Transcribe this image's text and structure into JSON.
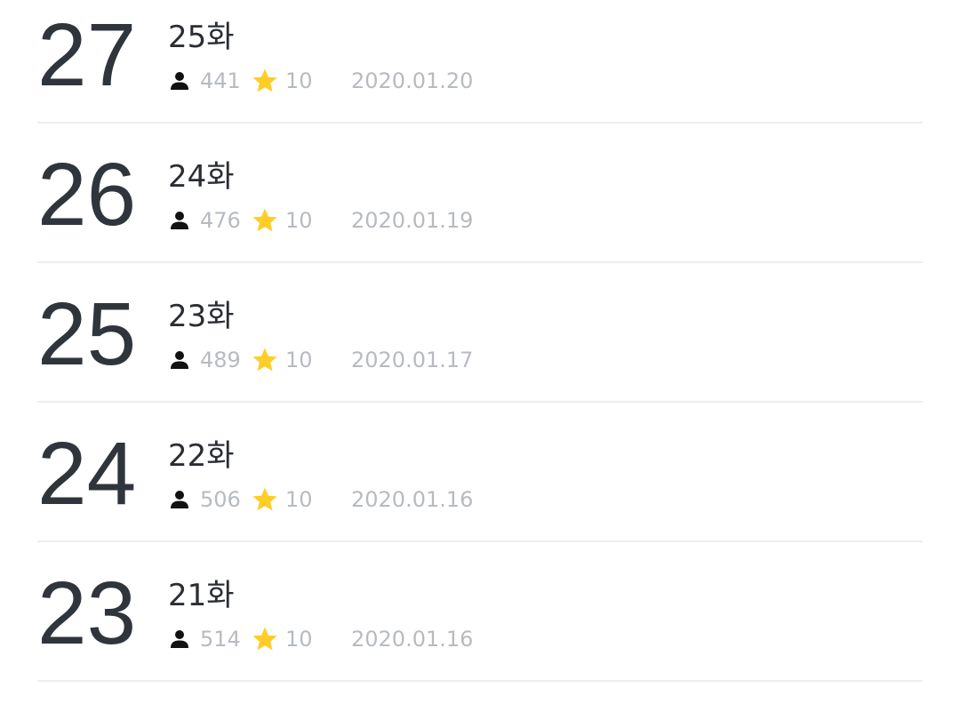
{
  "episodes": [
    {
      "number": "27",
      "title": "25화",
      "views": "441",
      "rating": "10",
      "date": "2020.01.20"
    },
    {
      "number": "26",
      "title": "24화",
      "views": "476",
      "rating": "10",
      "date": "2020.01.19"
    },
    {
      "number": "25",
      "title": "23화",
      "views": "489",
      "rating": "10",
      "date": "2020.01.17"
    },
    {
      "number": "24",
      "title": "22화",
      "views": "506",
      "rating": "10",
      "date": "2020.01.16"
    },
    {
      "number": "23",
      "title": "21화",
      "views": "514",
      "rating": "10",
      "date": "2020.01.16"
    }
  ],
  "icons": {
    "viewer": "person-icon",
    "rating": "star-icon"
  },
  "colors": {
    "star": "#ffcd28",
    "number": "#30353c",
    "meta_text": "#b7bbc0",
    "divider": "#eeeeee"
  }
}
